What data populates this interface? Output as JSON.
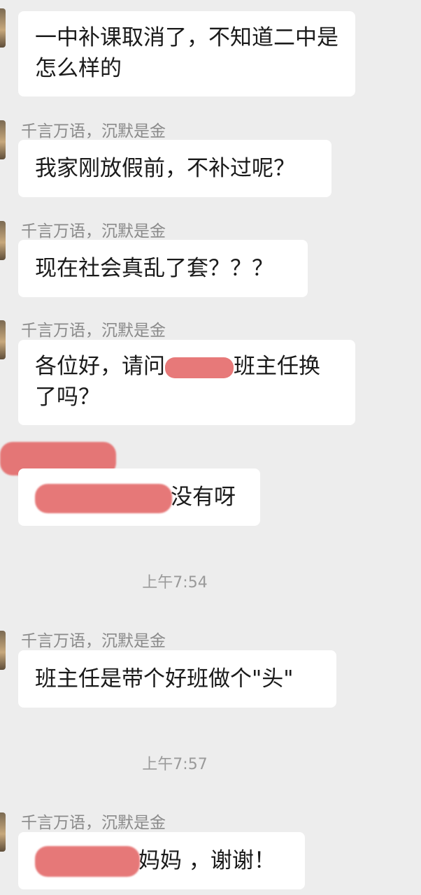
{
  "messages": [
    {
      "sender": "",
      "text": "一中补课取消了，不知道二中是怎么样的"
    },
    {
      "sender": "千言万语，沉默是金",
      "text": "我家刚放假前，不补过呢？"
    },
    {
      "sender": "千言万语，沉默是金",
      "text": "现在社会真乱了套？？？"
    },
    {
      "sender": "千言万语，沉默是金",
      "text_part1": "各位好，请问",
      "text_part2": "班主任换了吗？"
    },
    {
      "sender": "",
      "text": "没有呀"
    },
    {
      "sender": "千言万语，沉默是金",
      "text": "班主任是带个好班做个\"头\""
    },
    {
      "sender": "千言万语，沉默是金",
      "text": "妈妈 ，谢谢！"
    }
  ],
  "timestamps": [
    "上午7:54",
    "上午7:57"
  ],
  "colors": {
    "background": "#ededed",
    "bubble": "#ffffff",
    "redaction": "#e46a6a"
  }
}
